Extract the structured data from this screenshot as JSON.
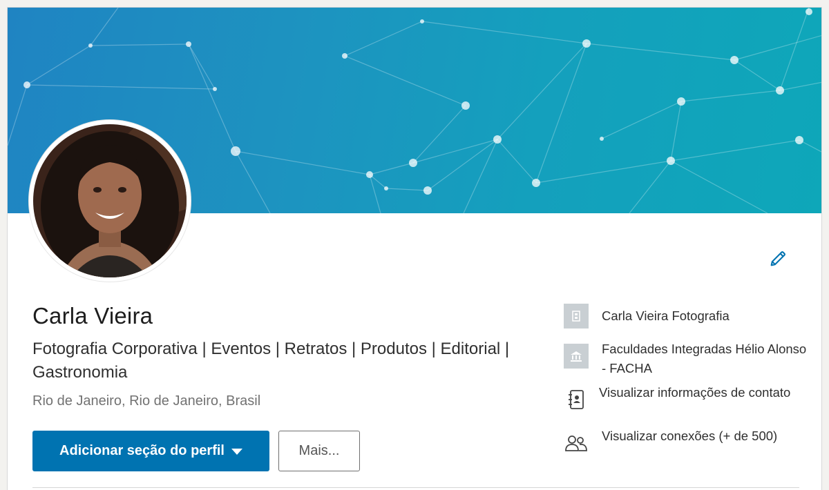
{
  "profile": {
    "name": "Carla Vieira",
    "headline": "Fotografia Corporativa | Eventos | Retratos | Produtos | Editorial | Gastronomia",
    "location": "Rio de Janeiro, Rio de Janeiro, Brasil"
  },
  "actions": {
    "add_section_label": "Adicionar seção do perfil",
    "more_label": "Mais..."
  },
  "sidebar": {
    "items": [
      {
        "label": "Carla Vieira Fotografia",
        "icon": "company-icon"
      },
      {
        "label": "Faculdades Integradas Hélio Alonso - FACHA",
        "icon": "school-icon"
      },
      {
        "label": "Visualizar informações de contato",
        "icon": "contact-card-icon"
      },
      {
        "label": "Visualizar conexões (+ de 500)",
        "icon": "connections-icon"
      }
    ]
  },
  "colors": {
    "primary_button": "#0073b1",
    "edit_icon": "#0073b1",
    "banner_start": "#1f84c2",
    "banner_end": "#0ea7b9"
  }
}
